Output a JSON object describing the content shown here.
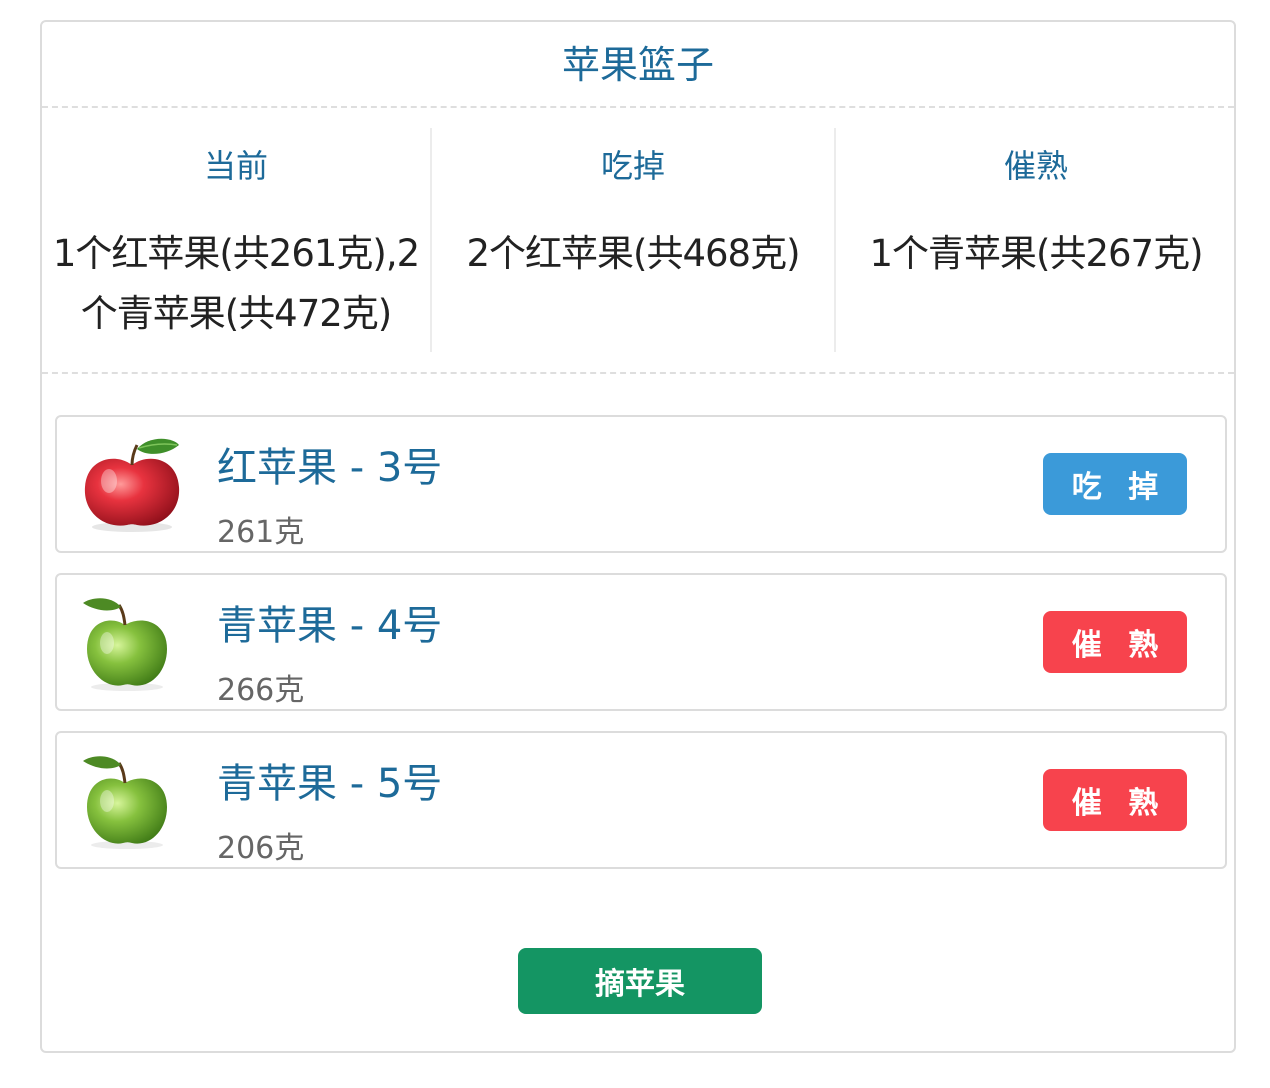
{
  "title": "苹果篮子",
  "stats": {
    "current": {
      "label": "当前",
      "value": "1个红苹果(共261克),2个青苹果(共472克)"
    },
    "eaten": {
      "label": "吃掉",
      "value": "2个红苹果(共468克)"
    },
    "ripen": {
      "label": "催熟",
      "value": "1个青苹果(共267克)"
    }
  },
  "apples": [
    {
      "name": "红苹果 - 3号",
      "weight": "261克",
      "kind": "red",
      "action": "吃 掉"
    },
    {
      "name": "青苹果 - 4号",
      "weight": "266克",
      "kind": "green",
      "action": "催 熟"
    },
    {
      "name": "青苹果 - 5号",
      "weight": "206克",
      "kind": "green",
      "action": "催 熟"
    }
  ],
  "pick_button": "摘苹果",
  "colors": {
    "title": "#1d6a99",
    "eat_button": "#3b9ad9",
    "ripen_button": "#f7434d",
    "pick_button": "#149563"
  },
  "icons": {
    "red_apple": "red-apple-icon",
    "green_apple": "green-apple-icon"
  }
}
